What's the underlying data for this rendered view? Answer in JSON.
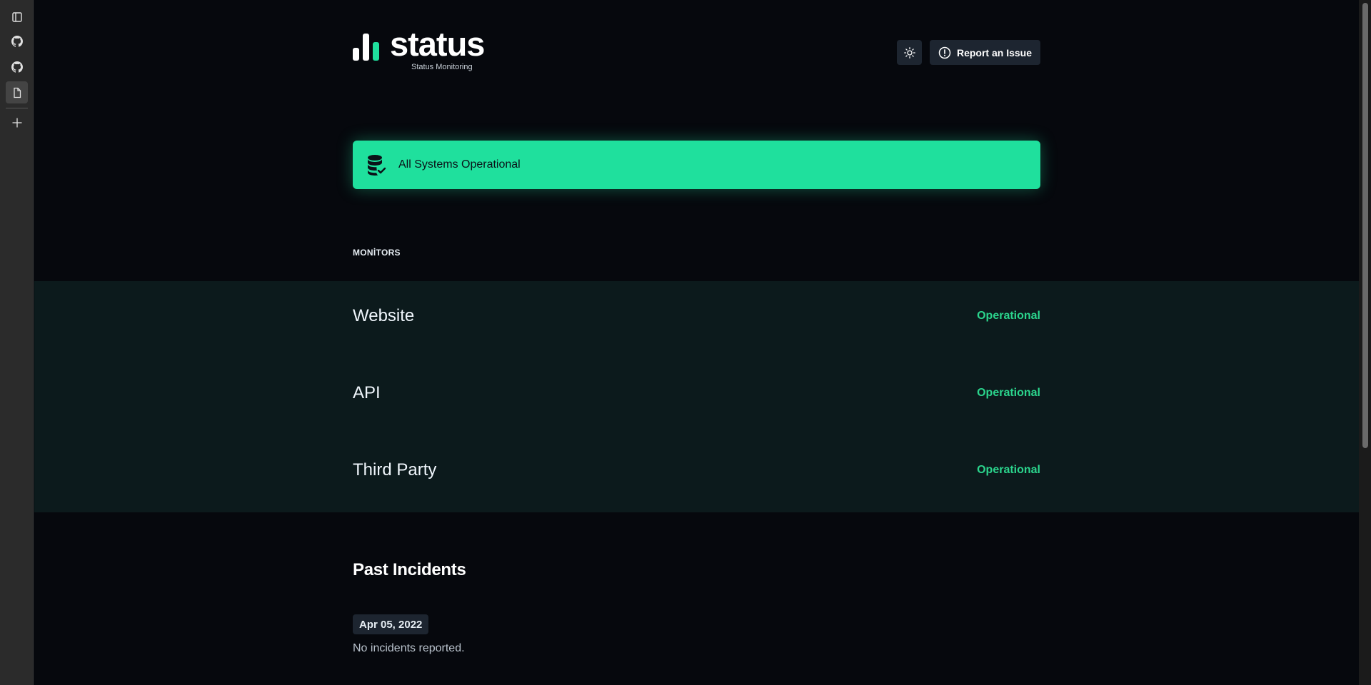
{
  "sidebar": {
    "icons": [
      "panel-icon",
      "github-icon",
      "github-icon",
      "document-icon",
      "plus-icon"
    ]
  },
  "header": {
    "logo_text": "status",
    "logo_subtitle": "Status Monitoring",
    "theme_toggle_icon": "sun-icon",
    "report_label": "Report an Issue"
  },
  "banner": {
    "text": "All Systems Operational",
    "color": "#1fe09d"
  },
  "monitors": {
    "title": "MONİTORS",
    "items": [
      {
        "name": "Website",
        "status": "Operational"
      },
      {
        "name": "API",
        "status": "Operational"
      },
      {
        "name": "Third Party",
        "status": "Operational"
      }
    ],
    "status_color": "#2bd58d"
  },
  "incidents": {
    "title": "Past Incidents",
    "date": "Apr 05, 2022",
    "message": "No incidents reported."
  }
}
